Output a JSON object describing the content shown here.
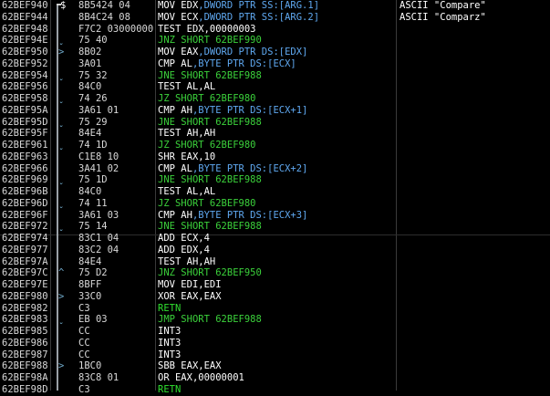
{
  "rows": [
    {
      "addr": "62BEF940",
      "mark": "$",
      "hex": "8B5424 04",
      "mn": "MOV",
      "ops": "EDX,DWORD PTR SS:[ARG.1]",
      "kind": "normal",
      "comment": "ASCII \"Compare\""
    },
    {
      "addr": "62BEF944",
      "mark": "",
      "hex": "8B4C24 08",
      "mn": "MOV",
      "ops": "ECX,DWORD PTR SS:[ARG.2]",
      "kind": "normal",
      "comment": "ASCII \"Comparz\""
    },
    {
      "addr": "62BEF948",
      "mark": "",
      "hex": "F7C2 03000000",
      "mn": "TEST",
      "ops": "EDX,00000003",
      "kind": "normal",
      "comment": ""
    },
    {
      "addr": "62BEF94E",
      "mark": "ˬ",
      "hex": "75 40",
      "mn": "JNZ",
      "ops": "SHORT 62BEF990",
      "kind": "jump",
      "comment": ""
    },
    {
      "addr": "62BEF950",
      "mark": ">",
      "hex": "8B02",
      "mn": "MOV",
      "ops": "EAX,DWORD PTR DS:[EDX]",
      "kind": "normal",
      "comment": ""
    },
    {
      "addr": "62BEF952",
      "mark": "",
      "hex": "3A01",
      "mn": "CMP",
      "ops": "AL,BYTE PTR DS:[ECX]",
      "kind": "normal",
      "comment": ""
    },
    {
      "addr": "62BEF954",
      "mark": "ˬ",
      "hex": "75 32",
      "mn": "JNE",
      "ops": "SHORT 62BEF988",
      "kind": "jump",
      "comment": ""
    },
    {
      "addr": "62BEF956",
      "mark": "",
      "hex": "84C0",
      "mn": "TEST",
      "ops": "AL,AL",
      "kind": "normal",
      "comment": ""
    },
    {
      "addr": "62BEF958",
      "mark": "ˬ",
      "hex": "74 26",
      "mn": "JZ",
      "ops": "SHORT 62BEF980",
      "kind": "jump",
      "comment": ""
    },
    {
      "addr": "62BEF95A",
      "mark": "",
      "hex": "3A61 01",
      "mn": "CMP",
      "ops": "AH,BYTE PTR DS:[ECX+1]",
      "kind": "normal",
      "comment": ""
    },
    {
      "addr": "62BEF95D",
      "mark": "ˬ",
      "hex": "75 29",
      "mn": "JNE",
      "ops": "SHORT 62BEF988",
      "kind": "jump",
      "comment": ""
    },
    {
      "addr": "62BEF95F",
      "mark": "",
      "hex": "84E4",
      "mn": "TEST",
      "ops": "AH,AH",
      "kind": "normal",
      "comment": ""
    },
    {
      "addr": "62BEF961",
      "mark": "ˬ",
      "hex": "74 1D",
      "mn": "JZ",
      "ops": "SHORT 62BEF980",
      "kind": "jump",
      "comment": ""
    },
    {
      "addr": "62BEF963",
      "mark": "",
      "hex": "C1E8 10",
      "mn": "SHR",
      "ops": "EAX,10",
      "kind": "normal",
      "comment": ""
    },
    {
      "addr": "62BEF966",
      "mark": "",
      "hex": "3A41 02",
      "mn": "CMP",
      "ops": "AL,BYTE PTR DS:[ECX+2]",
      "kind": "normal",
      "comment": ""
    },
    {
      "addr": "62BEF969",
      "mark": "ˬ",
      "hex": "75 1D",
      "mn": "JNE",
      "ops": "SHORT 62BEF988",
      "kind": "jump",
      "comment": ""
    },
    {
      "addr": "62BEF96B",
      "mark": "",
      "hex": "84C0",
      "mn": "TEST",
      "ops": "AL,AL",
      "kind": "normal",
      "comment": ""
    },
    {
      "addr": "62BEF96D",
      "mark": "ˬ",
      "hex": "74 11",
      "mn": "JZ",
      "ops": "SHORT 62BEF980",
      "kind": "jump",
      "comment": ""
    },
    {
      "addr": "62BEF96F",
      "mark": "",
      "hex": "3A61 03",
      "mn": "CMP",
      "ops": "AH,BYTE PTR DS:[ECX+3]",
      "kind": "normal",
      "comment": ""
    },
    {
      "addr": "62BEF972",
      "mark": "ˬ",
      "hex": "75 14",
      "mn": "JNE",
      "ops": "SHORT 62BEF988",
      "kind": "jump",
      "comment": ""
    },
    {
      "addr": "62BEF974",
      "mark": "",
      "hex": "83C1 04",
      "mn": "ADD",
      "ops": "ECX,4",
      "kind": "normal",
      "comment": ""
    },
    {
      "addr": "62BEF977",
      "mark": "",
      "hex": "83C2 04",
      "mn": "ADD",
      "ops": "EDX,4",
      "kind": "normal",
      "comment": ""
    },
    {
      "addr": "62BEF97A",
      "mark": "",
      "hex": "84E4",
      "mn": "TEST",
      "ops": "AH,AH",
      "kind": "normal",
      "comment": ""
    },
    {
      "addr": "62BEF97C",
      "mark": "^",
      "hex": "75 D2",
      "mn": "JNZ",
      "ops": "SHORT 62BEF950",
      "kind": "jump",
      "comment": ""
    },
    {
      "addr": "62BEF97E",
      "mark": "",
      "hex": "8BFF",
      "mn": "MOV",
      "ops": "EDI,EDI",
      "kind": "normal",
      "comment": ""
    },
    {
      "addr": "62BEF980",
      "mark": ">",
      "hex": "33C0",
      "mn": "XOR",
      "ops": "EAX,EAX",
      "kind": "normal",
      "comment": ""
    },
    {
      "addr": "62BEF982",
      "mark": "",
      "hex": "C3",
      "mn": "RETN",
      "ops": "",
      "kind": "ret",
      "comment": ""
    },
    {
      "addr": "62BEF983",
      "mark": "ˬ",
      "hex": "EB 03",
      "mn": "JMP",
      "ops": "SHORT 62BEF988",
      "kind": "jump",
      "comment": ""
    },
    {
      "addr": "62BEF985",
      "mark": "",
      "hex": "CC",
      "mn": "INT3",
      "ops": "",
      "kind": "normal",
      "comment": ""
    },
    {
      "addr": "62BEF986",
      "mark": "",
      "hex": "CC",
      "mn": "INT3",
      "ops": "",
      "kind": "normal",
      "comment": ""
    },
    {
      "addr": "62BEF987",
      "mark": "",
      "hex": "CC",
      "mn": "INT3",
      "ops": "",
      "kind": "normal",
      "comment": ""
    },
    {
      "addr": "62BEF988",
      "mark": ">",
      "hex": "1BC0",
      "mn": "SBB",
      "ops": "EAX,EAX",
      "kind": "normal",
      "comment": ""
    },
    {
      "addr": "62BEF98A",
      "mark": "",
      "hex": "83C8 01",
      "mn": "OR",
      "ops": "EAX,00000001",
      "kind": "normal",
      "comment": ""
    },
    {
      "addr": "62BEF98D",
      "mark": "",
      "hex": "C3",
      "mn": "RETN",
      "ops": "",
      "kind": "ret",
      "comment": ""
    }
  ]
}
